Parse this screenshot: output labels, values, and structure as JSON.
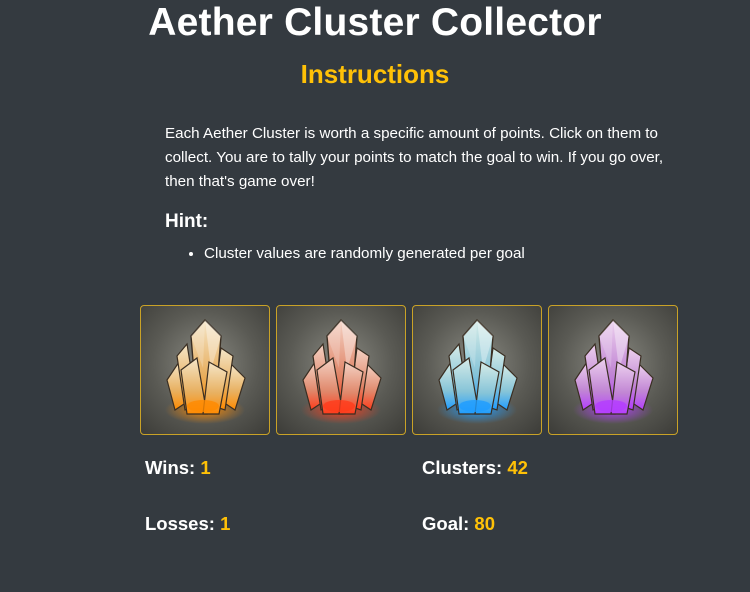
{
  "header": {
    "title": "Aether Cluster Collector",
    "subtitle": "Instructions"
  },
  "instructions": {
    "text": "Each Aether Cluster is worth a specific amount of points. Click on them to collect. You are to tally your points to match the goal to win. If you go over, then that's game over!",
    "hint_title": "Hint:",
    "hints": [
      "Cluster values are randomly generated per goal"
    ]
  },
  "crystals": [
    {
      "name": "fire-crystal",
      "light": "#f5e6c8",
      "mid": "#e8b060",
      "glow": "#ff8a00"
    },
    {
      "name": "lightning-crystal",
      "light": "#f4d2c4",
      "mid": "#e0876a",
      "glow": "#ff3b1a"
    },
    {
      "name": "ice-crystal",
      "light": "#d6ece8",
      "mid": "#86c4d8",
      "glow": "#1e9cff"
    },
    {
      "name": "wind-crystal",
      "light": "#ecd0ee",
      "mid": "#c185d4",
      "glow": "#b43cff"
    }
  ],
  "stats": {
    "wins_label": "Wins:",
    "wins": "1",
    "losses_label": "Losses:",
    "losses": "1",
    "clusters_label": "Clusters:",
    "clusters": "42",
    "goal_label": "Goal:",
    "goal": "80"
  }
}
